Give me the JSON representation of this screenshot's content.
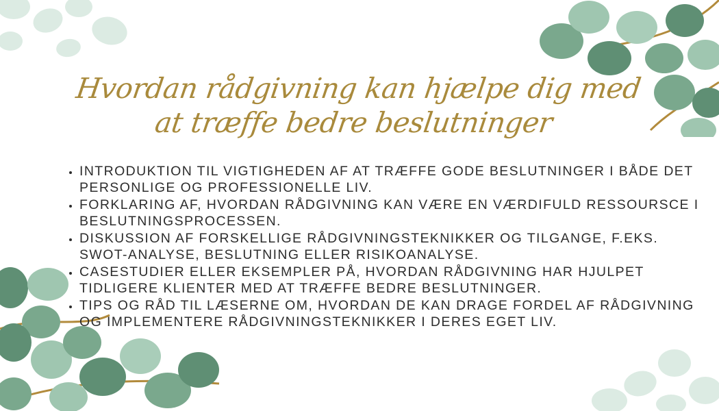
{
  "title": "Hvordan rådgivning kan hjælpe dig med at træffe bedre beslutninger",
  "bullets": [
    "Introduktion til vigtigheden af at træffe gode beslutninger i både det personlige og professionelle liv.",
    "Forklaring af, hvordan rådgivning kan være en værdifuld ressoursce i beslutningsprocessen.",
    "Diskussion af forskellige rådgivningsteknikker og tilgange, f.eks. SWOT-analyse, beslutning eller risikoanalyse.",
    "Casestudier eller eksempler på, hvordan rådgivning har hjulpet tidligere klienter med at træffe bedre beslutninger.",
    "Tips og råd til læserne om, hvordan de kan drage fordel af rådgivning og implementere rådgivningsteknikker i deres eget liv."
  ],
  "colors": {
    "title": "#a98a3c",
    "text": "#2d2d2d",
    "leaf_dark": "#5f8f74",
    "leaf_light": "#cfe4da",
    "stem": "#b28b3c"
  },
  "icons": [
    "eucalyptus-leaves-illustration"
  ]
}
